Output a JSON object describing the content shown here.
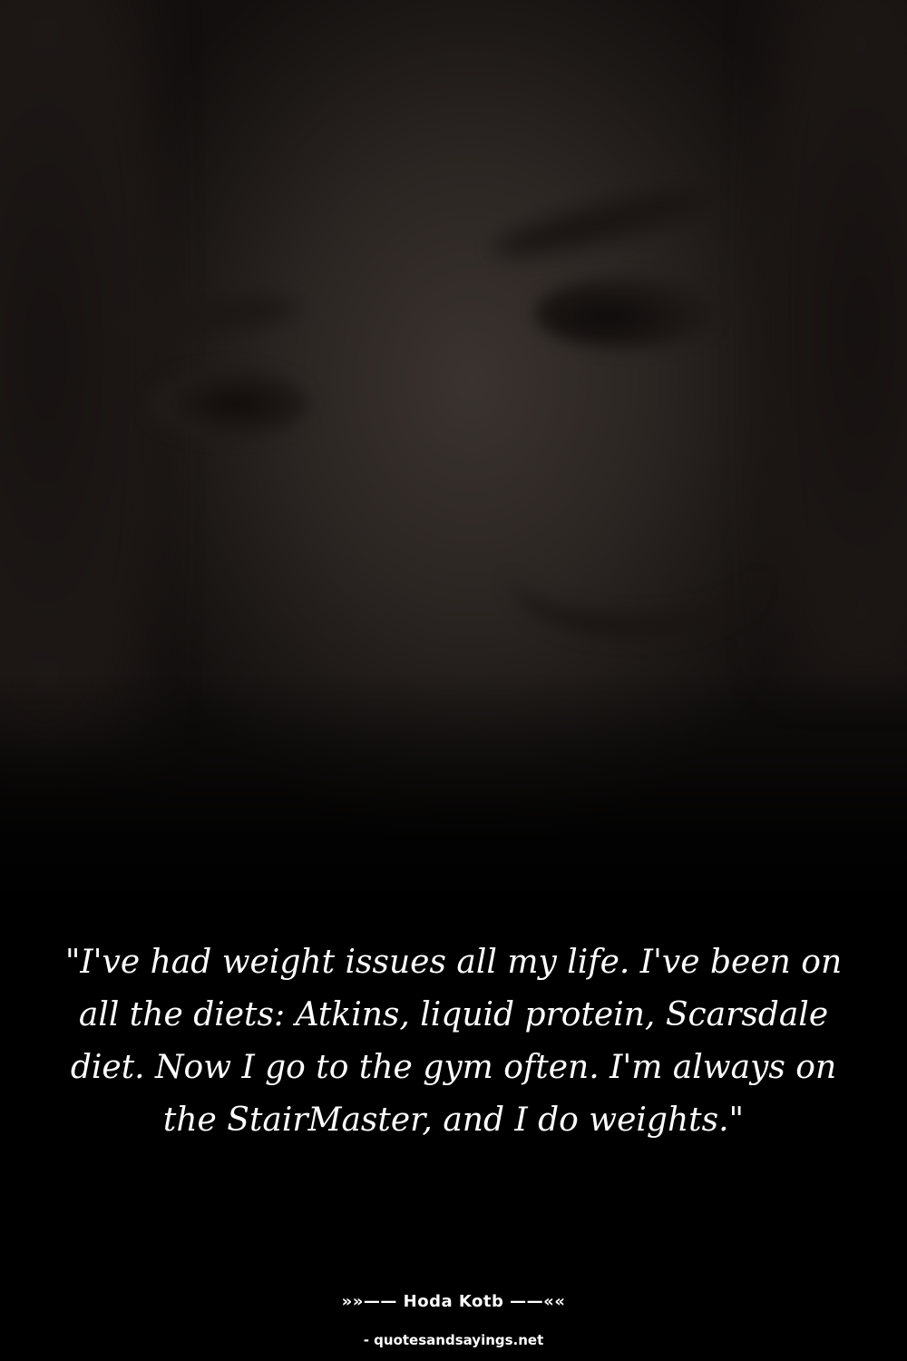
{
  "quote": {
    "text": "\"I've had weight issues all my life. I've been on all the diets: Atkins, liquid protein, Scarsdale diet. Now I go to the gym often. I'm always on the StairMaster, and I do weights.\""
  },
  "attribution": {
    "author_line": "»»—— Hoda Kotb ——««",
    "source": "- quotesandsayings.net"
  },
  "colors": {
    "background": "#000000",
    "text": "#ffffff"
  }
}
